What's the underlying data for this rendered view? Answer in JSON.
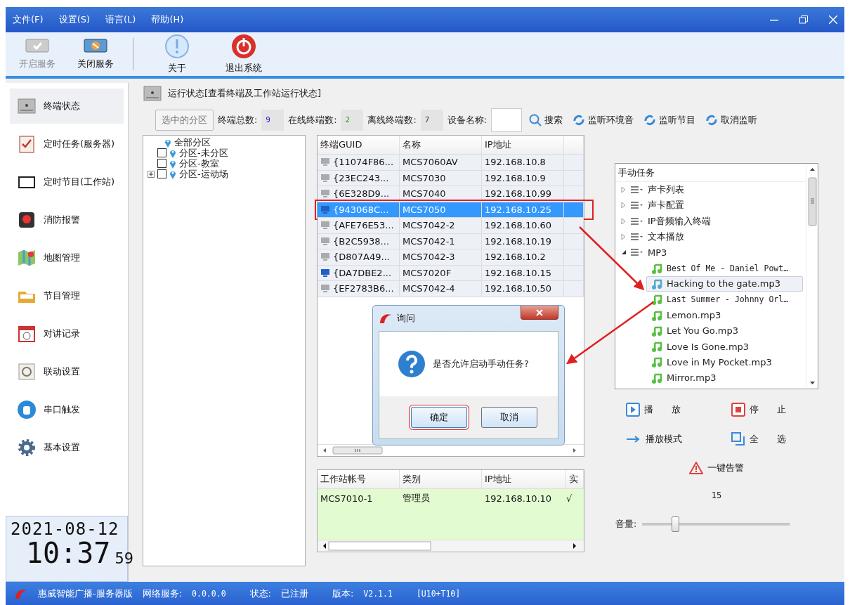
{
  "menu": [
    "文件(F)",
    "设置(S)",
    "语言(L)",
    "帮助(H)"
  ],
  "toolbar": [
    {
      "label": "开启服务",
      "kind": "start",
      "disabled": true
    },
    {
      "label": "关闭服务",
      "kind": "stop",
      "disabled": false
    },
    {
      "label": "关于",
      "kind": "about",
      "disabled": false
    },
    {
      "label": "退出系统",
      "kind": "exit",
      "disabled": false
    }
  ],
  "sidebar": [
    {
      "label": "终端状态",
      "kind": "terminal",
      "selected": true
    },
    {
      "label": "定时任务(服务器)",
      "kind": "clipboard",
      "selected": false
    },
    {
      "label": "定时节目(工作站)",
      "kind": "monitor",
      "selected": false
    },
    {
      "label": "消防报警",
      "kind": "alarm",
      "selected": false
    },
    {
      "label": "地图管理",
      "kind": "map",
      "selected": false
    },
    {
      "label": "节目管理",
      "kind": "folder",
      "selected": false
    },
    {
      "label": "对讲记录",
      "kind": "calendar",
      "selected": false
    },
    {
      "label": "联动设置",
      "kind": "link",
      "selected": false
    },
    {
      "label": "串口触发",
      "kind": "hand",
      "selected": false
    },
    {
      "label": "基本设置",
      "kind": "gear",
      "selected": false
    }
  ],
  "clock": {
    "date": "2021-08-12",
    "time": "10:37",
    "seconds": "59"
  },
  "panel": {
    "title": "运行状态[查看终端及工作站运行状态]"
  },
  "filter": {
    "zone_button": "选中的分区",
    "stats": [
      {
        "label": "终端总数:",
        "value": "9",
        "color": "#2020c0"
      },
      {
        "label": "在线终端数:",
        "value": "2",
        "color": "#20a020"
      },
      {
        "label": "离线终端数:",
        "value": "7",
        "color": "#404040"
      }
    ],
    "device_label": "设备名称:",
    "search": "搜索",
    "actions": [
      "监听环境音",
      "监听节目",
      "取消监听"
    ]
  },
  "zone_tree": {
    "label": "全部分区",
    "children": [
      {
        "label": "分区-未分区",
        "checked": false
      },
      {
        "label": "分区-教室",
        "checked": false
      },
      {
        "label": "分区-运动场",
        "checked": false,
        "expanded": false
      }
    ]
  },
  "terminals": {
    "columns": [
      "终端GUID",
      "名称",
      "IP地址"
    ],
    "rows": [
      {
        "guid": "{11074F86...",
        "name": "MCS7060AV",
        "ip": "192.168.10.8",
        "online": false,
        "selected": false
      },
      {
        "guid": "{23EC243...",
        "name": "MCS7030",
        "ip": "192.168.10.9",
        "online": false,
        "selected": false
      },
      {
        "guid": "{6E328D9...",
        "name": "MCS7040",
        "ip": "192.168.10.99",
        "online": false,
        "selected": false
      },
      {
        "guid": "{943068C...",
        "name": "MCS7050",
        "ip": "192.168.10.25",
        "online": true,
        "selected": true
      },
      {
        "guid": "{AFE76E53...",
        "name": "MCS7042-2",
        "ip": "192.168.10.60",
        "online": false,
        "selected": false
      },
      {
        "guid": "{B2C5938...",
        "name": "MCS7042-1",
        "ip": "192.168.10.19",
        "online": false,
        "selected": false
      },
      {
        "guid": "{D807A49...",
        "name": "MCS7042-3",
        "ip": "192.168.10.2",
        "online": false,
        "selected": false
      },
      {
        "guid": "{DA7DBE2...",
        "name": "MCS7020F",
        "ip": "192.168.10.15",
        "online": true,
        "selected": false
      },
      {
        "guid": "{EF2783B6...",
        "name": "MCS7042-4",
        "ip": "192.168.10.50",
        "online": false,
        "selected": false
      }
    ]
  },
  "workstations": {
    "columns": [
      "工作站帐号",
      "类别",
      "IP地址",
      "实"
    ],
    "rows": [
      {
        "account": "MCS7010-1",
        "role": "管理员",
        "ip": "192.168.10.10",
        "column_4": "√"
      }
    ]
  },
  "tasks": {
    "title": "手动任务",
    "groups": [
      {
        "label": "声卡列表",
        "expanded": false
      },
      {
        "label": "声卡配置",
        "expanded": false
      },
      {
        "label": "IP音频输入终端",
        "expanded": false
      },
      {
        "label": "文本播放",
        "expanded": false
      },
      {
        "label": "MP3",
        "expanded": true,
        "children": [
          {
            "label": "Best Of Me - Daniel Powt…",
            "selected": false,
            "mono": true
          },
          {
            "label": "Hacking to the gate.mp3",
            "selected": true,
            "mono": false
          },
          {
            "label": "Last Summer - Johnny Orl…",
            "selected": false,
            "mono": true
          },
          {
            "label": "Lemon.mp3",
            "selected": false,
            "mono": false
          },
          {
            "label": "Let You Go.mp3",
            "selected": false,
            "mono": false
          },
          {
            "label": "Love Is Gone.mp3",
            "selected": false,
            "mono": false
          },
          {
            "label": "Love in My Pocket.mp3",
            "selected": false,
            "mono": false
          },
          {
            "label": "Mirror.mp3",
            "selected": false,
            "mono": false
          }
        ]
      }
    ]
  },
  "controls": [
    {
      "label": "播　　放",
      "kind": "play"
    },
    {
      "label": "停　　止",
      "kind": "stop"
    },
    {
      "label": "播放模式",
      "kind": "mode"
    },
    {
      "label": "全　　选",
      "kind": "select"
    }
  ],
  "alarm": "一键告警",
  "volume": {
    "value": "15",
    "label": "音量:",
    "level": 0.2
  },
  "dialog": {
    "title": "询问",
    "message": "是否允许启动手动任务?",
    "buttons": [
      {
        "label": "确定",
        "default": true
      },
      {
        "label": "取消",
        "default": false
      }
    ]
  },
  "status_bar": [
    "惠威智能广播-服务器版",
    "网络服务:",
    "0.0.0.0",
    "状态:",
    "已注册",
    "版本:",
    "V2.1.1",
    "[U10+T10]"
  ]
}
